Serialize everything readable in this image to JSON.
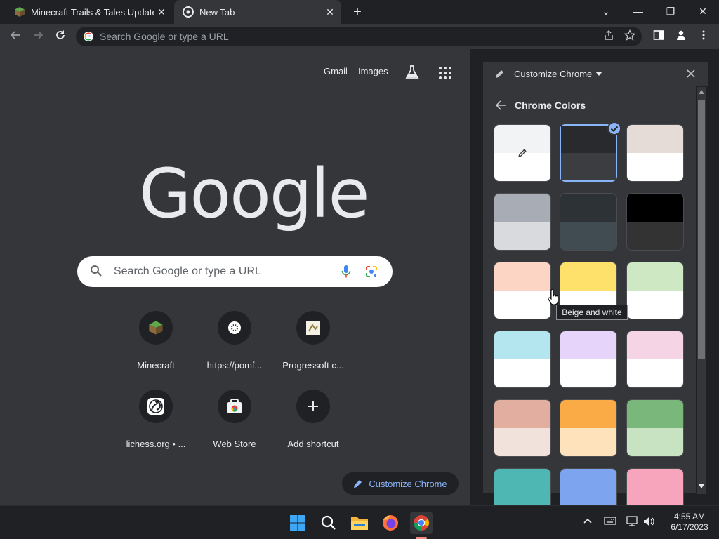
{
  "tabs": [
    {
      "title": "Minecraft Trails & Tales Update |",
      "close": "✕"
    },
    {
      "title": "New Tab",
      "close": "✕"
    }
  ],
  "new_tab_symbol": "+",
  "window_controls": {
    "list": "⌄",
    "minimize": "—",
    "restore": "❐",
    "close": "✕"
  },
  "omnibox": {
    "placeholder": "Search Google or type a URL"
  },
  "ntp": {
    "links": [
      "Gmail",
      "Images"
    ],
    "logo": "Google",
    "search_placeholder": "Search Google or type a URL",
    "shortcuts": [
      {
        "label": "Minecraft",
        "icon": "minecraft-icon"
      },
      {
        "label": "https://pomf...",
        "icon": "pomf-icon"
      },
      {
        "label": "Progressoft c...",
        "icon": "progressoft-icon"
      },
      {
        "label": "lichess.org • ...",
        "icon": "lichess-icon"
      },
      {
        "label": "Web Store",
        "icon": "webstore-icon"
      },
      {
        "label": "Add shortcut",
        "icon": "plus-icon"
      }
    ],
    "customize_label": "Customize Chrome"
  },
  "panel": {
    "title": "Customize Chrome",
    "section": "Chrome Colors",
    "tooltip": "Beige and white",
    "swatches": [
      {
        "top": "#f1f3f4",
        "bottom": "#ffffff",
        "kind": "custom"
      },
      {
        "top": "#292a2d",
        "bottom": "#3c3d41",
        "kind": "selected"
      },
      {
        "top": "#e6dcd7",
        "bottom": "#ffffff"
      },
      {
        "top": "#a8acb4",
        "bottom": "#d9dadd"
      },
      {
        "top": "#2c3236",
        "bottom": "#414b52"
      },
      {
        "top": "#000000",
        "bottom": "#333333"
      },
      {
        "top": "#fcd5c4",
        "bottom": "#ffffff"
      },
      {
        "top": "#fde16a",
        "bottom": "#ffffff"
      },
      {
        "top": "#cde8c3",
        "bottom": "#ffffff"
      },
      {
        "top": "#b3e6ef",
        "bottom": "#ffffff"
      },
      {
        "top": "#e6d4fb",
        "bottom": "#ffffff"
      },
      {
        "top": "#f5d4e6",
        "bottom": "#ffffff"
      },
      {
        "top": "#e1aea0",
        "bottom": "#f2e2dc"
      },
      {
        "top": "#fbab45",
        "bottom": "#fde2bb"
      },
      {
        "top": "#79b87a",
        "bottom": "#c7e3c2"
      },
      {
        "top": "#4fb7b3",
        "bottom": "#4fb7b3"
      },
      {
        "top": "#7da4ee",
        "bottom": "#7da4ee"
      },
      {
        "top": "#f7a5bd",
        "bottom": "#f7a5bd"
      }
    ]
  },
  "taskbar": {
    "apps": [
      "windows-start-icon",
      "search-icon",
      "file-explorer-icon",
      "firefox-icon",
      "chrome-icon"
    ],
    "time": "4:55 AM",
    "date": "6/17/2023"
  },
  "colors": {
    "accent": "#8ab4f8",
    "panel_bg": "#35363a",
    "frame_bg": "#202124"
  }
}
